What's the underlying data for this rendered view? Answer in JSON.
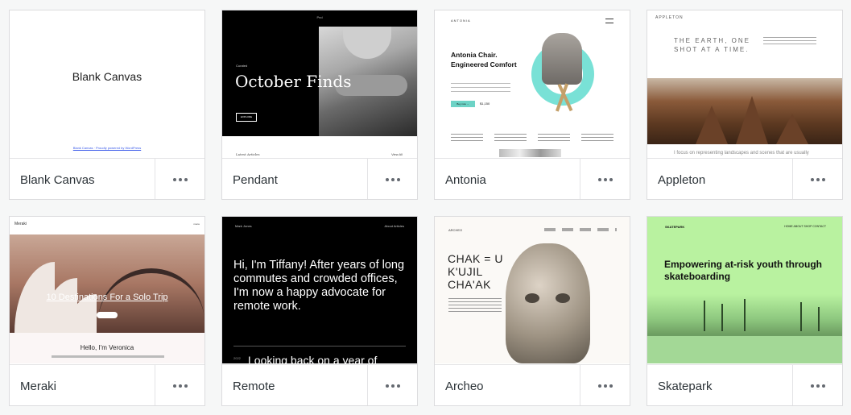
{
  "themes": [
    {
      "name": "Blank Canvas",
      "preview": {
        "title": "Blank Canvas",
        "footer": "Blank Canvas · Proudly powered by WordPress"
      }
    },
    {
      "name": "Pendant",
      "preview": {
        "site": "Pnd",
        "kicker": "Curated",
        "title": "October Finds",
        "button": "EXPLORE",
        "latest": "Latest Articles",
        "view_all": "View All"
      }
    },
    {
      "name": "Antonia",
      "preview": {
        "brand": "ANTONIA",
        "headline": "Antonia Chair. Engineered Comfort",
        "buy": "Buy now →",
        "price": "$1,150"
      }
    },
    {
      "name": "Appleton",
      "preview": {
        "brand": "APPLETON",
        "slogan": "THE EARTH, ONE SHOT AT A TIME.",
        "caption": "I focus on representing landscapes and scenes that are usually"
      }
    },
    {
      "name": "Meraki",
      "preview": {
        "brand": "Meraki",
        "menu": "menu",
        "hero_title": "10 Destinations For a Solo Trip",
        "hello": "Hello, I'm Veronica"
      }
    },
    {
      "name": "Remote",
      "preview": {
        "author": "Mark Jones",
        "links": "About   Articles",
        "intro": "Hi, I'm Tiffany! After years of long commutes and crowded offices, I'm now a happy advocate for remote work.",
        "more": "Looking back on a year of",
        "tag": "2022"
      }
    },
    {
      "name": "Archeo",
      "preview": {
        "brand": "ARCHEO",
        "headline": "CHAK = U K'UJIL CHA'AK"
      }
    },
    {
      "name": "Skatepark",
      "preview": {
        "brand": "SKATEPARK",
        "nav": "HOME   ABOUT   SHOP   CONTACT",
        "headline": "Empowering at-risk youth through skateboarding"
      }
    }
  ],
  "colors": {
    "card_border": "#dcdcde",
    "name_text": "#2c3338",
    "menu_dots": "#646970",
    "page_bg": "#f6f7f7"
  },
  "icons": {
    "more": "more-horizontal-icon"
  }
}
